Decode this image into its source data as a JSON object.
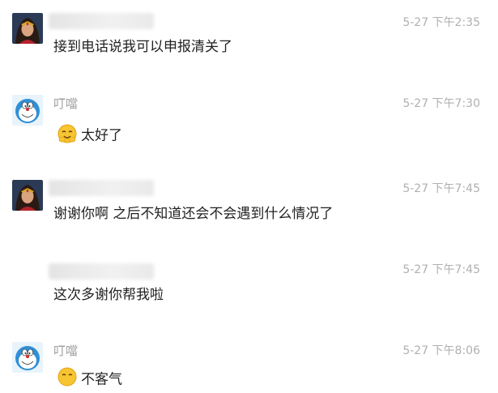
{
  "messages": [
    {
      "sender": "",
      "time": "5-27 下午2:35",
      "text": "接到电话说我可以申报清关了",
      "avatar": "wonder-woman-avatar"
    },
    {
      "sender": "叮噹",
      "time": "5-27 下午7:30",
      "text": "太好了",
      "avatar": "doraemon-avatar",
      "emoji": "giggle-emoji"
    },
    {
      "sender": "",
      "time": "5-27 下午7:45",
      "text": "谢谢你啊 之后不知道还会不会遇到什么情况了",
      "avatar": "wonder-woman-avatar"
    },
    {
      "sender": "",
      "time": "5-27 下午7:45",
      "text": "这次多谢你帮我啦"
    },
    {
      "sender": "叮噹",
      "time": "5-27 下午8:06",
      "text": "不客气",
      "avatar": "doraemon-avatar",
      "emoji": "smile-emoji"
    }
  ],
  "colors": {
    "name": "#a0a0a0",
    "time": "#b0b0b0",
    "text": "#222222"
  }
}
